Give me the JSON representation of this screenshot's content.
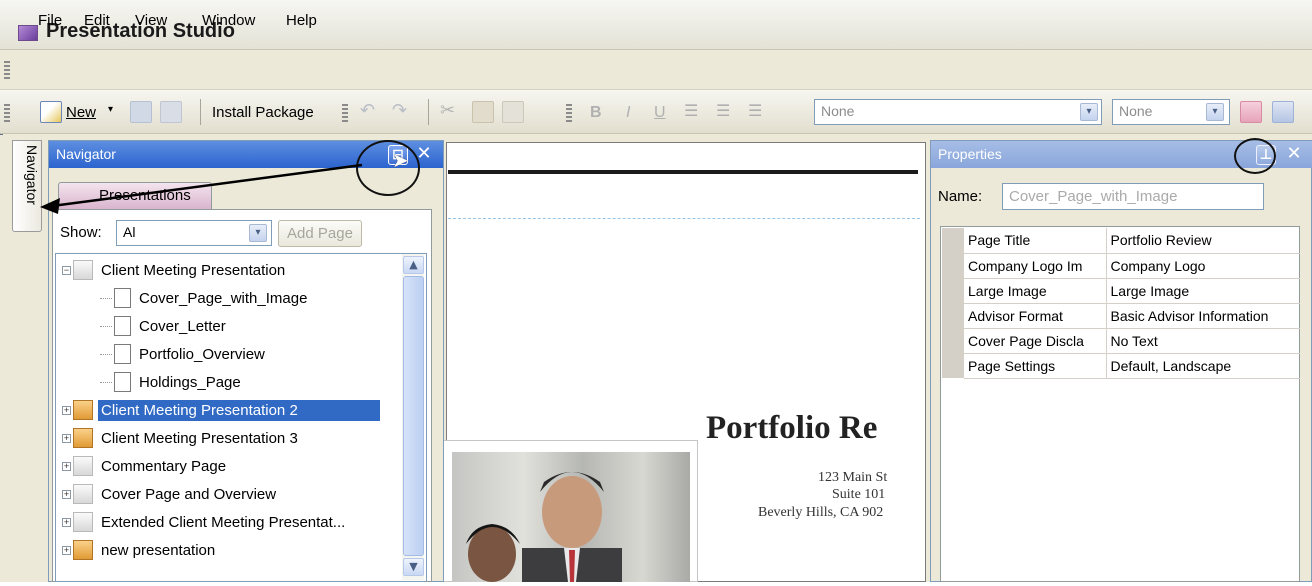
{
  "app": {
    "title": "Presentation Studio"
  },
  "menu": [
    "File",
    "Edit",
    "View",
    "Window",
    "Help"
  ],
  "toolbar": {
    "new_label": "New",
    "install_label": "Install Package",
    "style_combo_value": "None",
    "size_combo_value": "None",
    "bold": "B",
    "italic": "I",
    "underline": "U"
  },
  "side_tab": {
    "label": "Navigator"
  },
  "navigator": {
    "title": "Navigator",
    "tab": "Presentations",
    "show_label": "Show:",
    "show_value": "Al",
    "add_page_label": "Add Page",
    "tree": [
      {
        "label": "Client Meeting Presentation",
        "level": 0,
        "icon": "book-gray",
        "expander": "minus"
      },
      {
        "label": "Cover_Page_with_Image",
        "level": 1,
        "icon": "page"
      },
      {
        "label": "Cover_Letter",
        "level": 1,
        "icon": "page"
      },
      {
        "label": "Portfolio_Overview",
        "level": 1,
        "icon": "page"
      },
      {
        "label": "Holdings_Page",
        "level": 1,
        "icon": "page"
      },
      {
        "label": "Client Meeting Presentation 2",
        "level": 0,
        "icon": "book",
        "expander": "plus",
        "selected": true
      },
      {
        "label": "Client Meeting Presentation 3",
        "level": 0,
        "icon": "book",
        "expander": "plus"
      },
      {
        "label": "Commentary Page",
        "level": 0,
        "icon": "gray",
        "expander": "plus"
      },
      {
        "label": "Cover Page and Overview",
        "level": 0,
        "icon": "gray",
        "expander": "plus"
      },
      {
        "label": "Extended Client Meeting Presentat...",
        "level": 0,
        "icon": "gray",
        "expander": "plus"
      },
      {
        "label": "new presentation",
        "level": 0,
        "icon": "book",
        "expander": "plus"
      }
    ]
  },
  "document": {
    "title": "Portfolio Re",
    "address": [
      "123 Main St",
      "Suite 101",
      "Beverly Hills, CA 902"
    ]
  },
  "properties": {
    "title": "Properties",
    "name_label": "Name:",
    "name_value": "Cover_Page_with_Image",
    "rows": [
      {
        "key": "Page Title",
        "value": "Portfolio Review"
      },
      {
        "key": "Company Logo Im",
        "value": "Company Logo"
      },
      {
        "key": "Large Image",
        "value": "Large Image"
      },
      {
        "key": "Advisor Format",
        "value": "Basic Advisor Information"
      },
      {
        "key": "Cover Page Discla",
        "value": "No Text"
      },
      {
        "key": "Page Settings",
        "value": "Default, Landscape"
      }
    ]
  },
  "colors": {
    "selection": "#316ac5",
    "nav_header": "#2c64cf",
    "props_header": "#89a5da"
  }
}
